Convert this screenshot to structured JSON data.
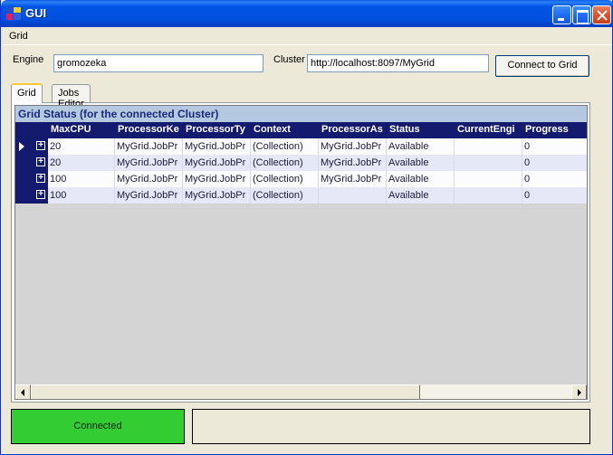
{
  "window": {
    "title": "GUI",
    "controls": {
      "minimize": "minimize",
      "maximize": "maximize",
      "close": "close"
    }
  },
  "menu": {
    "items": [
      {
        "label": "Grid"
      }
    ]
  },
  "form": {
    "engine_label": "Engine",
    "engine_value": "gromozeka",
    "cluster_label": "Cluster",
    "cluster_value": "http://localhost:8097/MyGrid",
    "connect_button": "Connect to Grid"
  },
  "tabs": [
    {
      "label": "Grid",
      "active": true
    },
    {
      "label": "Jobs Editor",
      "active": false
    }
  ],
  "grid": {
    "caption": "Grid Status (for the connected Cluster)",
    "columns": [
      "MaxCPU",
      "ProcessorKe",
      "ProcessorTy",
      "Context",
      "ProcessorAs",
      "Status",
      "CurrentEngi",
      "Progress"
    ],
    "rows": [
      [
        "20",
        "MyGrid.JobPr",
        "MyGrid.JobPr",
        "(Collection)",
        "MyGrid.JobPr",
        "Available",
        "",
        "0"
      ],
      [
        "20",
        "MyGrid.JobPr",
        "MyGrid.JobPr",
        "(Collection)",
        "MyGrid.JobPr",
        "Available",
        "",
        "0"
      ],
      [
        "100",
        "MyGrid.JobPr",
        "MyGrid.JobPr",
        "(Collection)",
        "MyGrid.JobPr",
        "Available",
        "",
        "0"
      ],
      [
        "100",
        "MyGrid.JobPr",
        "MyGrid.JobPr",
        "(Collection)",
        "",
        "Available",
        "",
        "0"
      ]
    ],
    "selected_row": 0
  },
  "status": {
    "connection": "Connected",
    "connection_color": "#33cc33",
    "message": ""
  }
}
